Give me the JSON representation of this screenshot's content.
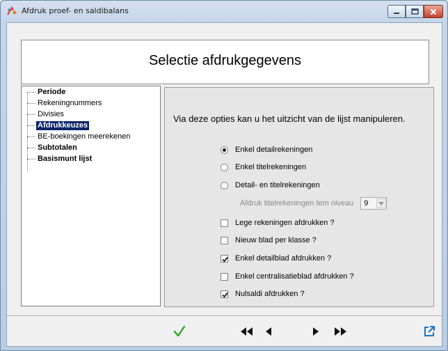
{
  "window": {
    "title": "Afdruk proef- en saldibalans"
  },
  "header": {
    "title": "Selectie afdrukgegevens"
  },
  "tree": {
    "items": [
      {
        "label": "Periode",
        "bold": true
      },
      {
        "label": "Rekeningnummers",
        "bold": false
      },
      {
        "label": "Divisies",
        "bold": false
      },
      {
        "label": "Afdrukkeuzes",
        "bold": true,
        "selected": true
      },
      {
        "label": "BE-boekingen meerekenen",
        "bold": false
      },
      {
        "label": "Subtotalen",
        "bold": true
      },
      {
        "label": "Basismunt lijst",
        "bold": true
      }
    ]
  },
  "panel": {
    "intro": "Via deze opties kan u het uitzicht van de lijst manipuleren.",
    "radios": [
      {
        "label": "Enkel detailrekeningen",
        "checked": true
      },
      {
        "label": "Enkel titelrekeningen",
        "checked": false
      },
      {
        "label": "Detail- en titelrekeningen",
        "checked": false
      }
    ],
    "level_label": "Afdruk titelrekeningen tem niveau",
    "level_value": "9",
    "checkboxes": [
      {
        "label": "Lege rekeningen afdrukken ?",
        "checked": false
      },
      {
        "label": "Nieuw blad per klasse ?",
        "checked": false
      },
      {
        "label": "Enkel detailblad afdrukken ?",
        "checked": true
      },
      {
        "label": "Enkel centralisatieblad afdrukken ?",
        "checked": false
      },
      {
        "label": "Nulsaldi afdrukken ?",
        "checked": true
      }
    ]
  },
  "toolbar": {
    "icons": [
      "confirm-check-icon",
      "first-record-icon",
      "previous-record-icon",
      "next-record-icon",
      "last-record-icon",
      "export-open-icon"
    ],
    "accent_green": "#2aa52a",
    "accent_blue": "#1e73c8"
  }
}
